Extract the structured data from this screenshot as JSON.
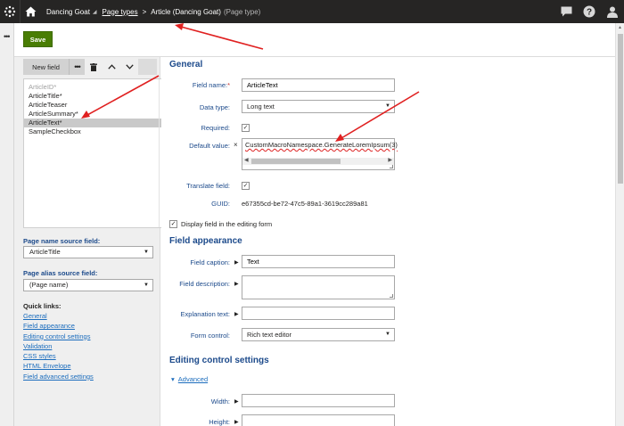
{
  "topbar": {
    "site_name": "Dancing Goat",
    "breadcrumb_link": "Page types",
    "breadcrumb_current": "Article (Dancing Goat)",
    "breadcrumb_suffix": "(Page type)"
  },
  "header": {
    "save_label": "Save"
  },
  "fields_toolbar": {
    "new_field_label": "New field"
  },
  "field_list": [
    {
      "label": "ArticleID*",
      "state": "disabled"
    },
    {
      "label": "ArticleTitle*",
      "state": "normal"
    },
    {
      "label": "ArticleTeaser",
      "state": "normal"
    },
    {
      "label": "ArticleSummary*",
      "state": "normal"
    },
    {
      "label": "ArticleText*",
      "state": "selected"
    },
    {
      "label": "SampleCheckbox",
      "state": "normal"
    }
  ],
  "left_panel": {
    "page_name_label": "Page name source field:",
    "page_name_value": "ArticleTitle",
    "page_alias_label": "Page alias source field:",
    "page_alias_value": "(Page name)",
    "quick_links_title": "Quick links:",
    "quick_links": [
      "General",
      "Field appearance",
      "Editing control settings",
      "Validation",
      "CSS styles",
      "HTML Envelope",
      "Field advanced settings"
    ]
  },
  "general": {
    "title": "General",
    "field_name_label": "Field name:",
    "field_name_value": "ArticleText",
    "data_type_label": "Data type:",
    "data_type_value": "Long text",
    "required_label": "Required:",
    "required_checked": true,
    "default_value_label": "Default value:",
    "default_value": "CustomMacroNamespace.GenerateLoremIpsum(3)",
    "translate_label": "Translate field:",
    "translate_checked": true,
    "guid_label": "GUID:",
    "guid_value": "e67355cd-be72-47c5-89a1-3619cc289a81",
    "display_label": "Display field in the editing form",
    "display_checked": true
  },
  "appearance": {
    "title": "Field appearance",
    "caption_label": "Field caption:",
    "caption_value": "Text",
    "description_label": "Field description:",
    "explanation_label": "Explanation text:",
    "form_control_label": "Form control:",
    "form_control_value": "Rich text editor"
  },
  "editing": {
    "title": "Editing control settings",
    "advanced_label": "Advanced",
    "width_label": "Width:",
    "height_label": "Height:"
  },
  "icons": {
    "logo": "kentico-logo-icon",
    "home": "home-icon",
    "chat": "chat-icon",
    "help": "help-icon",
    "user": "user-icon"
  },
  "colors": {
    "topbar": "#262524",
    "save_button": "#497d04",
    "label_blue": "#1c4a8b",
    "link_blue": "#1c6dbd",
    "required_red": "#c3322c",
    "annotation_arrow": "#e02020"
  }
}
